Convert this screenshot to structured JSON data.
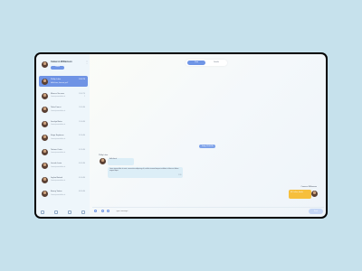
{
  "profile": {
    "name": "Cameron Williamson",
    "status": "Online"
  },
  "contacts": [
    {
      "name": "Phillip Lubin",
      "message": "Hello there, how are you?",
      "time": "12:45 PM",
      "badge": "",
      "active": true
    },
    {
      "name": "Marcus Vaccaro",
      "message": "Lorem ipsum dolor sit",
      "time": "12:00 PM",
      "badge": "2",
      "active": false
    },
    {
      "name": "Talan Franci",
      "message": "Lorem ipsum dolor sit",
      "time": "11:45 AM",
      "badge": "",
      "active": false
    },
    {
      "name": "Jocelyn Bator",
      "message": "Lorem ipsum dolor sit",
      "time": "11:00 AM",
      "badge": "",
      "active": false
    },
    {
      "name": "Kaiya Septimus",
      "message": "Lorem ipsum dolor sit",
      "time": "10:50 AM",
      "badge": "",
      "active": false
    },
    {
      "name": "Tatiana Curtis",
      "message": "Lorem ipsum dolor sit",
      "time": "10:20 AM",
      "badge": "",
      "active": false
    },
    {
      "name": "Lincoln Levin",
      "message": "Lorem ipsum dolor sit",
      "time": "09:45 AM",
      "badge": "",
      "active": false
    },
    {
      "name": "Jaylon Botosh",
      "message": "Lorem ipsum dolor sit",
      "time": "09:00 AM",
      "badge": "",
      "active": false
    },
    {
      "name": "Emery Vetrov",
      "message": "Lorem ipsum dolor sit",
      "time": "08:30 AM",
      "badge": "",
      "active": false
    }
  ],
  "tabs": {
    "chat": "Chat",
    "other": "Details"
  },
  "date_divider": "Today, 12:30 PM",
  "incoming": {
    "name": "Phillip Lubin",
    "msg1": "Hello there!",
    "msg2": "Lorem ipsum dolor sit amet, consectetur adipiscing elit, sed do eiusmod tempor incididunt ut labore et dolore magna aliqua.",
    "time2": "12:45"
  },
  "outgoing": {
    "name": "Cameron Williamson",
    "msg": "Hi! I'm fine, thanks",
    "time": "12:46"
  },
  "composer": {
    "placeholder": "Type a message...",
    "send": "Send"
  },
  "colors": {
    "accent": "#6f95e6",
    "outgoing_bubble": "#f6bf3c",
    "incoming_bubble": "#dceef7",
    "background": "#c6e1ec"
  }
}
